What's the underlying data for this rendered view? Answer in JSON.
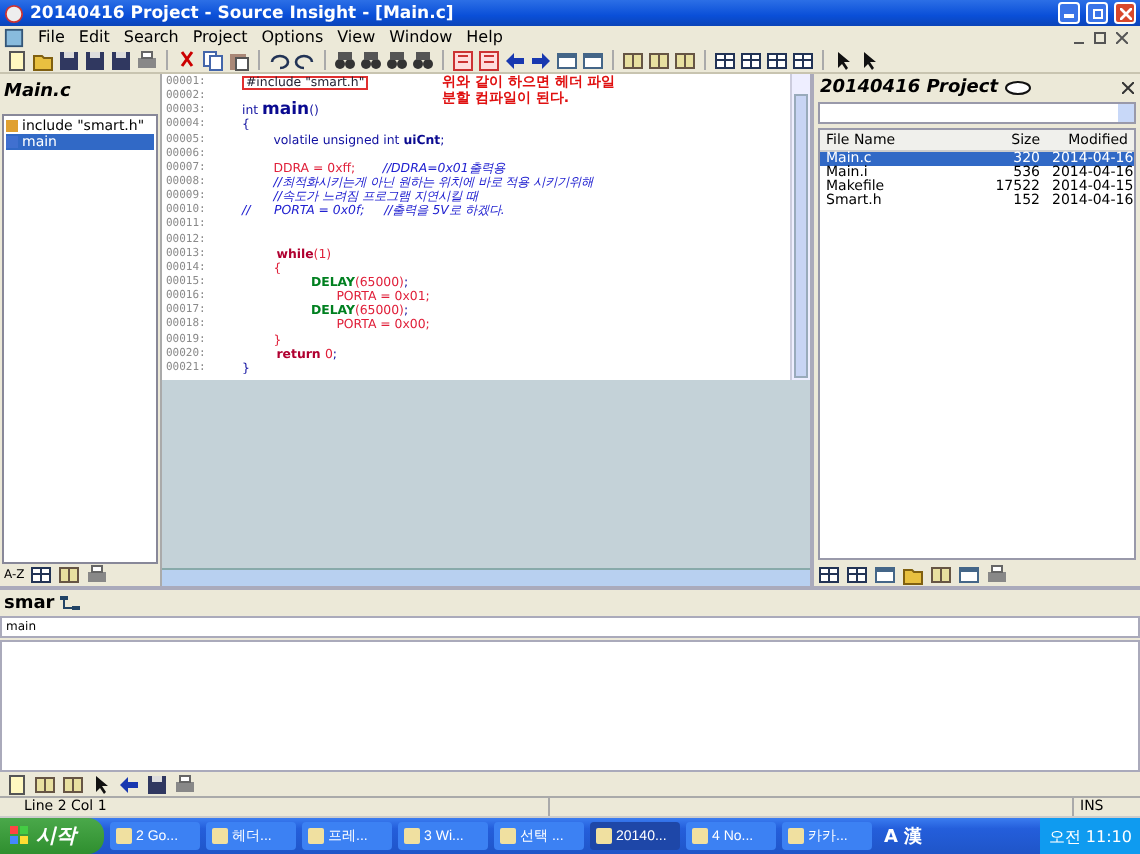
{
  "window": {
    "title": "20140416 Project - Source Insight - [Main.c]"
  },
  "menu": [
    "File",
    "Edit",
    "Search",
    "Project",
    "Options",
    "View",
    "Window",
    "Help"
  ],
  "symbol_panel": {
    "title": "Main.c",
    "items": [
      {
        "text": "include \"smart.h\"",
        "kind": "include",
        "selected": false
      },
      {
        "text": "main",
        "kind": "function",
        "selected": true
      }
    ]
  },
  "editor": {
    "annotation": [
      "위와 같이 하으면 헤더 파일",
      "분할 컴파일이 된다."
    ],
    "lines": [
      {
        "no": "00001:",
        "tokens": [
          {
            "kind": "boxed",
            "text": "#include \"smart.h\""
          }
        ]
      },
      {
        "no": "00002:"
      },
      {
        "no": "00003:",
        "tokens": [
          {
            "kind": "keyword",
            "text": "int "
          },
          {
            "kind": "funcdef",
            "text": "main"
          },
          {
            "kind": "plain",
            "text": "()"
          }
        ]
      },
      {
        "no": "00004:",
        "tokens": [
          {
            "kind": "plain",
            "text": "{"
          }
        ]
      },
      {
        "no": "00005:",
        "tokens": [
          {
            "kind": "keyword",
            "text": "        volatile unsigned int "
          },
          {
            "kind": "ident",
            "text": "uiCnt"
          },
          {
            "kind": "plain",
            "text": ";"
          }
        ]
      },
      {
        "no": "00006:"
      },
      {
        "no": "00007:",
        "tokens": [
          {
            "kind": "macro",
            "text": "        DDRA = 0xff;"
          },
          {
            "kind": "comment",
            "text": "       //DDRA=0x01출력용"
          }
        ]
      },
      {
        "no": "00008:",
        "tokens": [
          {
            "kind": "comment",
            "text": "        //최적화시키는게 아닌 원하는 위치에 바로 적용 시키기위해"
          }
        ]
      },
      {
        "no": "00009:",
        "tokens": [
          {
            "kind": "comment",
            "text": "        //속도가 느려짐 프로그램 지연시킬 때"
          }
        ]
      },
      {
        "no": "00010:",
        "tokens": [
          {
            "kind": "comment",
            "text": "//      PORTA = 0x0f;     //출력을 5V로 하겠다."
          }
        ]
      },
      {
        "no": "00011:"
      },
      {
        "no": "00012:"
      },
      {
        "no": "00013:",
        "tokens": [
          {
            "kind": "control",
            "text": "        while"
          },
          {
            "kind": "macro",
            "text": "(1)"
          }
        ]
      },
      {
        "no": "00014:",
        "tokens": [
          {
            "kind": "macro",
            "text": "        {"
          }
        ]
      },
      {
        "no": "00015:",
        "tokens": [
          {
            "kind": "call",
            "text": "                DELAY"
          },
          {
            "kind": "macro",
            "text": "(65000)"
          },
          {
            "kind": "plain",
            "text": ";"
          }
        ]
      },
      {
        "no": "00016:",
        "tokens": [
          {
            "kind": "macro",
            "text": "                        PORTA = 0x01;"
          }
        ]
      },
      {
        "no": "00017:",
        "tokens": [
          {
            "kind": "call",
            "text": "                DELAY"
          },
          {
            "kind": "macro",
            "text": "(65000)"
          },
          {
            "kind": "plain",
            "text": ";"
          }
        ]
      },
      {
        "no": "00018:",
        "tokens": [
          {
            "kind": "macro",
            "text": "                        PORTA = 0x00;"
          }
        ]
      },
      {
        "no": "00019:",
        "tokens": [
          {
            "kind": "macro",
            "text": "        }"
          }
        ]
      },
      {
        "no": "00020:",
        "tokens": [
          {
            "kind": "control",
            "text": "        return "
          },
          {
            "kind": "macro",
            "text": "0"
          },
          {
            "kind": "plain",
            "text": ";"
          }
        ]
      },
      {
        "no": "00021:",
        "tokens": [
          {
            "kind": "plain",
            "text": "}"
          }
        ]
      }
    ]
  },
  "project_panel": {
    "title": "20140416 Project",
    "columns": [
      "File Name",
      "Size",
      "Modified"
    ],
    "rows": [
      {
        "name": "Main.c",
        "size": "320",
        "modified": "2014-04-16",
        "selected": true
      },
      {
        "name": "Main.i",
        "size": "536",
        "modified": "2014-04-16",
        "selected": false
      },
      {
        "name": "Makefile",
        "size": "17522",
        "modified": "2014-04-15",
        "selected": false
      },
      {
        "name": "Smart.h",
        "size": "152",
        "modified": "2014-04-16",
        "selected": false
      }
    ]
  },
  "sort_label": "A-Z",
  "relation_panel": {
    "title": "smar",
    "query": "main"
  },
  "status_bar": {
    "position": "Line 2  Col 1",
    "mode": "INS"
  },
  "taskbar": {
    "start": "시작",
    "items": [
      {
        "label": "2 Go...",
        "selected": false
      },
      {
        "label": "헤더...",
        "selected": false
      },
      {
        "label": "프레...",
        "selected": false
      },
      {
        "label": "3 Wi...",
        "selected": false
      },
      {
        "label": "선택 ...",
        "selected": false
      },
      {
        "label": "20140...",
        "selected": true
      },
      {
        "label": "4 No...",
        "selected": false
      },
      {
        "label": "카카...",
        "selected": false
      }
    ],
    "ime": "A 漢",
    "clock": "오전 11:10"
  }
}
